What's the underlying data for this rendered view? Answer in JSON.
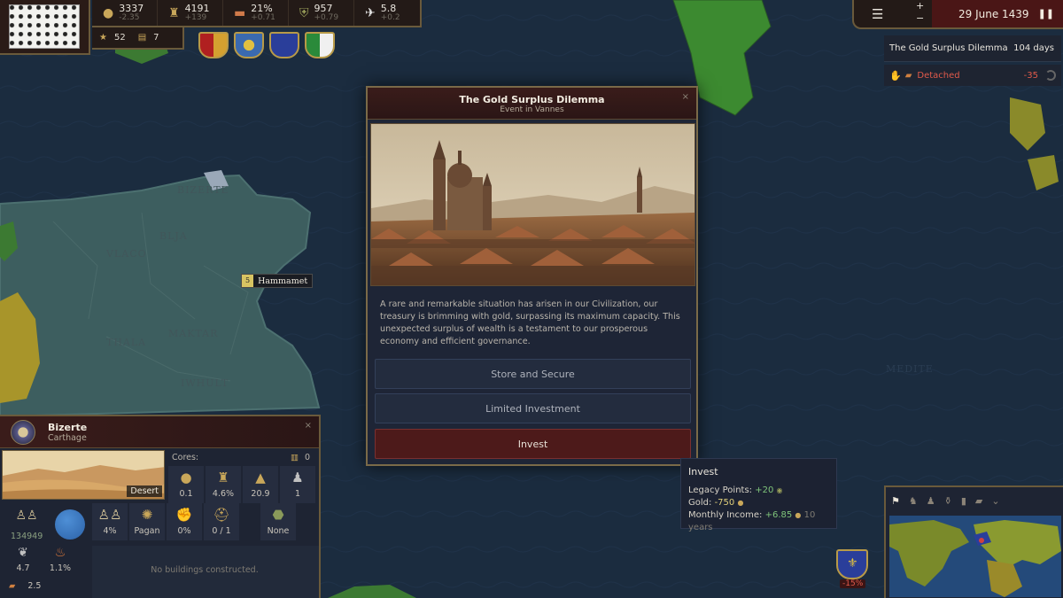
{
  "top_bar": {
    "resources": [
      {
        "name": "gold",
        "icon": "gold-coins-icon",
        "value": "3337",
        "delta": "-2.35"
      },
      {
        "name": "manpower",
        "icon": "soldier-icon",
        "value": "4191",
        "delta": "+139"
      },
      {
        "name": "stability",
        "icon": "scroll-icon",
        "value": "21%",
        "delta": "+0.71"
      },
      {
        "name": "prestige",
        "icon": "shield-crest-icon",
        "value": "957",
        "delta": "+0.79"
      },
      {
        "name": "legacy",
        "icon": "dove-icon",
        "value": "5.8",
        "delta": "+0.2"
      }
    ],
    "sub": {
      "stars": "52",
      "scrolls": "7"
    }
  },
  "date": {
    "text": "29 June 1439"
  },
  "zoom": {
    "plus": "+",
    "minus": "−"
  },
  "notifications": {
    "event_title": "The Gold Surplus Dilemma",
    "event_days": "104 days",
    "detached_label": "Detached",
    "detached_value": "-35"
  },
  "map_labels": {
    "hammamet": "Hammamet",
    "hammamet_badge": "5"
  },
  "event": {
    "title": "The Gold Surplus Dilemma",
    "subtitle": "Event in Vannes",
    "close": "×",
    "description": "A rare and remarkable situation has arisen in our Civilization, our treasury is brimming with gold, surpassing its maximum capacity. This unexpected surplus of wealth is a testament to our prosperous economy and efficient governance.",
    "options": [
      {
        "label": "Store and Secure"
      },
      {
        "label": "Limited Investment"
      },
      {
        "label": "Invest"
      }
    ]
  },
  "tooltip": {
    "title": "Invest",
    "legacy_label": "Legacy Points:",
    "legacy_value": "+20",
    "gold_label": "Gold:",
    "gold_value": "-750",
    "income_label": "Monthly Income:",
    "income_value": "+6.85",
    "income_duration": "10 years"
  },
  "province": {
    "name": "Bizerte",
    "owner": "Carthage",
    "close": "×",
    "terrain": "Desert",
    "cores_label": "Cores:",
    "cores_value": "0",
    "row1": [
      {
        "icon": "gold-coins-icon",
        "value": "0.1"
      },
      {
        "icon": "sack-icon",
        "value": "4.6%"
      },
      {
        "icon": "building-icon",
        "value": "20.9"
      },
      {
        "icon": "soldier-icon",
        "value": "1"
      }
    ],
    "row2": [
      {
        "icon": "people-icon",
        "value": "4%"
      },
      {
        "icon": "religion-wheel-icon",
        "value": "Pagan"
      },
      {
        "icon": "fist-icon",
        "value": "0%"
      },
      {
        "icon": "helmet-icon",
        "value": "0 / 1"
      },
      {
        "icon": "trade-good-icon",
        "value": "None"
      }
    ],
    "population": "134949",
    "growth": "4.7",
    "unrest": "1.1%",
    "devastation": "2.5",
    "no_buildings": "No buildings constructed."
  },
  "minimap": {
    "tabs": [
      "flag-tab",
      "army-tab",
      "trade-tab",
      "religion-tab",
      "diplomacy-tab",
      "economy-tab",
      "expand-tab"
    ]
  },
  "army": {
    "percent": "-15%"
  },
  "colors": {
    "ui_dark": "#231a17",
    "ui_gold_border": "#6a5a3b",
    "header_red": "#3a1c1a",
    "selected_option": "#4d1a1a",
    "sea": "#1b2c3f",
    "land_teal": "#3d5e5f",
    "positive": "#7fc47a",
    "negative": "#e05a4a"
  }
}
